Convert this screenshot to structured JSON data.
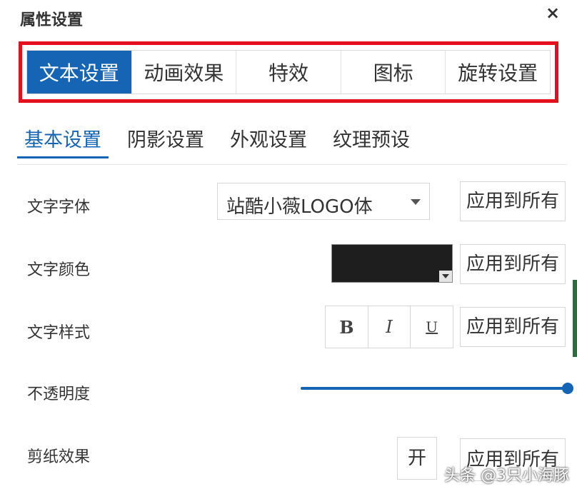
{
  "dialog": {
    "title": "属性设置",
    "close_symbol": "×"
  },
  "main_tabs": [
    {
      "label": "文本设置",
      "active": true
    },
    {
      "label": "动画效果",
      "active": false
    },
    {
      "label": "特效",
      "active": false
    },
    {
      "label": "图标",
      "active": false
    },
    {
      "label": "旋转设置",
      "active": false
    }
  ],
  "sub_tabs": [
    {
      "label": "基本设置",
      "active": true
    },
    {
      "label": "阴影设置",
      "active": false
    },
    {
      "label": "外观设置",
      "active": false
    },
    {
      "label": "纹理预设",
      "active": false
    }
  ],
  "rows": {
    "font": {
      "label": "文字字体",
      "value": "站酷小薇LOGO体",
      "apply_label": "应用到所有"
    },
    "color": {
      "label": "文字颜色",
      "value_hex": "#1e1e1e",
      "apply_label": "应用到所有"
    },
    "style": {
      "label": "文字样式",
      "bold": "B",
      "italic": "I",
      "underline": "U",
      "apply_label": "应用到所有"
    },
    "opacity": {
      "label": "不透明度",
      "value_fraction": 1.0
    },
    "papercut": {
      "label": "剪纸效果",
      "toggle_label": "开",
      "apply_label": "应用到所有"
    }
  },
  "colors": {
    "accent": "#1565b4",
    "highlight_frame": "#e3101c"
  },
  "watermark": "头条 @3只小海豚"
}
